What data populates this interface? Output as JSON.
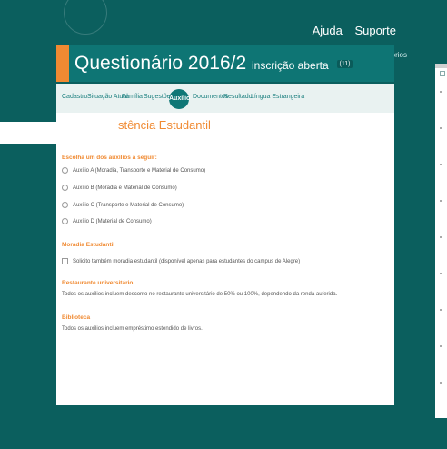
{
  "header": {
    "links": [
      "Ajuda",
      "Suporte"
    ],
    "required_note": "* Campos obrigatórios"
  },
  "titlebar": {
    "title": "Questionário 2016/2",
    "subtitle": "inscrição aberta",
    "id_badge": "(11)"
  },
  "tabs": [
    {
      "label": "Cadastro"
    },
    {
      "label": "Situação Atual"
    },
    {
      "label": "Família"
    },
    {
      "label": "Sugestões"
    },
    {
      "label": "Auxílio",
      "active": true
    },
    {
      "label": "Documentos"
    },
    {
      "label": "Resultado"
    },
    {
      "label": "Língua Estrangeira"
    }
  ],
  "main": {
    "heading": "stência Estudantil",
    "section_aid": "Escolha um dos auxílios a seguir:",
    "options": [
      "Auxílio A (Moradia, Transporte e Material de Consumo)",
      "Auxílio B (Moradia e Material de Consumo)",
      "Auxílio C (Transporte e Material de Consumo)",
      "Auxílio D (Material de Consumo)"
    ],
    "section_housing": "Moradia Estudantil",
    "housing_check": "Solicito também moradia estudantil (disponível apenas para estudantes do campus de Alegre)",
    "section_restaurant": "Restaurante universitário",
    "restaurant_text": "Todos os auxílios incluem desconto no restaurante universitário de 50% ou 100%, dependendo da renda auferida.",
    "section_library": "Biblioteca",
    "library_text": "Todos os auxílios incluem empréstimo estendido de livros."
  }
}
